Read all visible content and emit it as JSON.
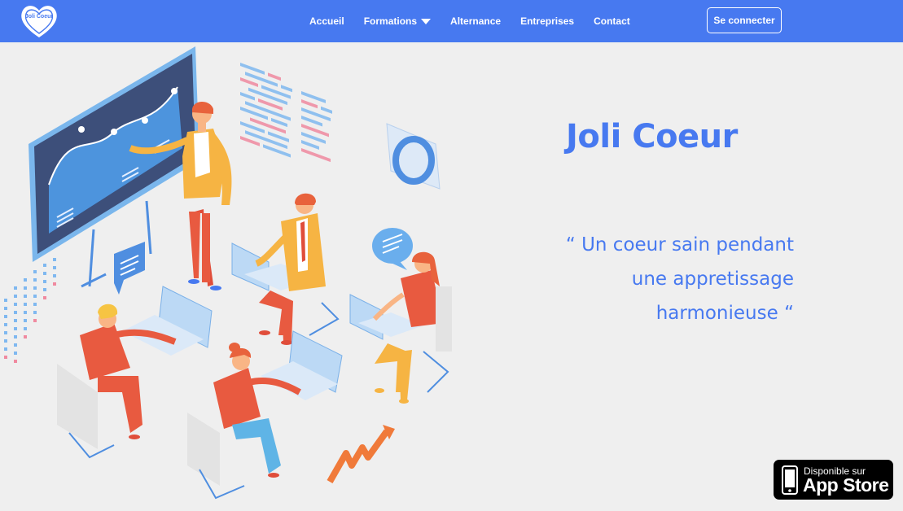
{
  "brand": {
    "logo_text": "Joli Coeur"
  },
  "nav": {
    "items": [
      {
        "label": "Accueil",
        "has_dropdown": false
      },
      {
        "label": "Formations",
        "has_dropdown": true
      },
      {
        "label": "Alternance",
        "has_dropdown": false
      },
      {
        "label": "Entreprises",
        "has_dropdown": false
      },
      {
        "label": "Contact",
        "has_dropdown": false
      }
    ],
    "login_label": "Se connecter"
  },
  "hero": {
    "title": "Joli Coeur",
    "quote_lines": [
      "“ Un coeur sain pendant",
      "une appretissage",
      "harmonieuse “"
    ]
  },
  "appstore": {
    "small": "Disponible sur",
    "big": "App Store"
  },
  "colors": {
    "brand_blue": "#4779f0",
    "background": "#efefef",
    "illustration_orange": "#f07a3a"
  },
  "icons": [
    "heart-logo-icon",
    "chevron-down-icon",
    "phone-icon"
  ]
}
